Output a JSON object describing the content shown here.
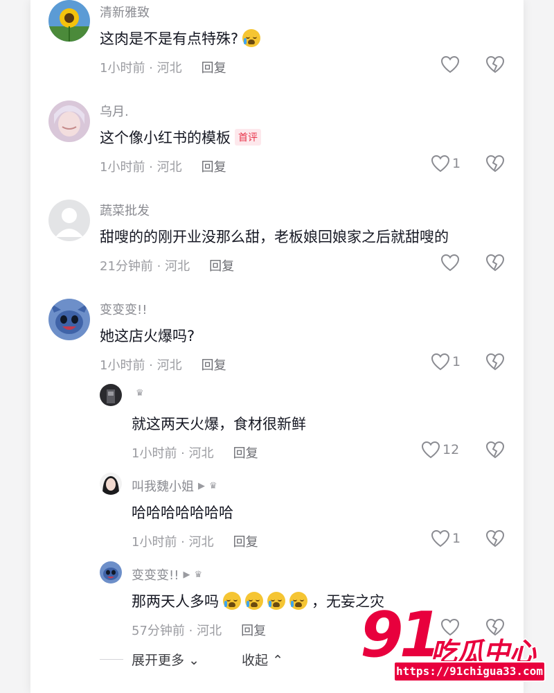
{
  "comments": [
    {
      "user": "清新雅致",
      "text": "这肉是不是有点特殊?",
      "time_location": "1小时前 · 河北",
      "reply_label": "回复",
      "likes": "",
      "avatar": "sunflower"
    },
    {
      "user": "乌月.",
      "text": "这个像小红书的模板",
      "tag": "首评",
      "time_location": "1小时前 · 河北",
      "reply_label": "回复",
      "likes": "1",
      "avatar": "anime-portrait"
    },
    {
      "user": "蔬菜批发",
      "text": "甜嗖的的刚开业没那么甜，老板娘回娘家之后就甜嗖的",
      "time_location": "21分钟前 · 河北",
      "reply_label": "回复",
      "likes": "",
      "avatar": "default-user"
    },
    {
      "user": "变变变!!",
      "text": "她这店火爆吗?",
      "time_location": "1小时前 · 河北",
      "reply_label": "回复",
      "likes": "1",
      "avatar": "stitch"
    }
  ],
  "replies": [
    {
      "user": "",
      "text": "就这两天火爆，食材很新鲜",
      "time_location": "1小时前 · 河北",
      "reply_label": "回复",
      "likes": "12",
      "avatar": "dark-photo"
    },
    {
      "user": "叫我魏小姐",
      "text": "哈哈哈哈哈哈哈",
      "time_location": "1小时前 · 河北",
      "reply_label": "回复",
      "likes": "1",
      "avatar": "girl-portrait"
    },
    {
      "user": "变变变!!",
      "text_before": "那两天人多吗",
      "text_after": "，无妄之灾",
      "time_location": "57分钟前 · 河北",
      "reply_label": "回复",
      "likes": "",
      "avatar": "stitch"
    }
  ],
  "footer": {
    "expand_label": "展开更多",
    "collapse_label": "收起"
  },
  "watermark": {
    "number": "91",
    "name": "吃瓜中心",
    "url": "https://91chigua33.com"
  },
  "colors": {
    "accent_red": "#e8003d",
    "tag_red": "#e8344a",
    "muted_text": "#9a9ba0"
  }
}
